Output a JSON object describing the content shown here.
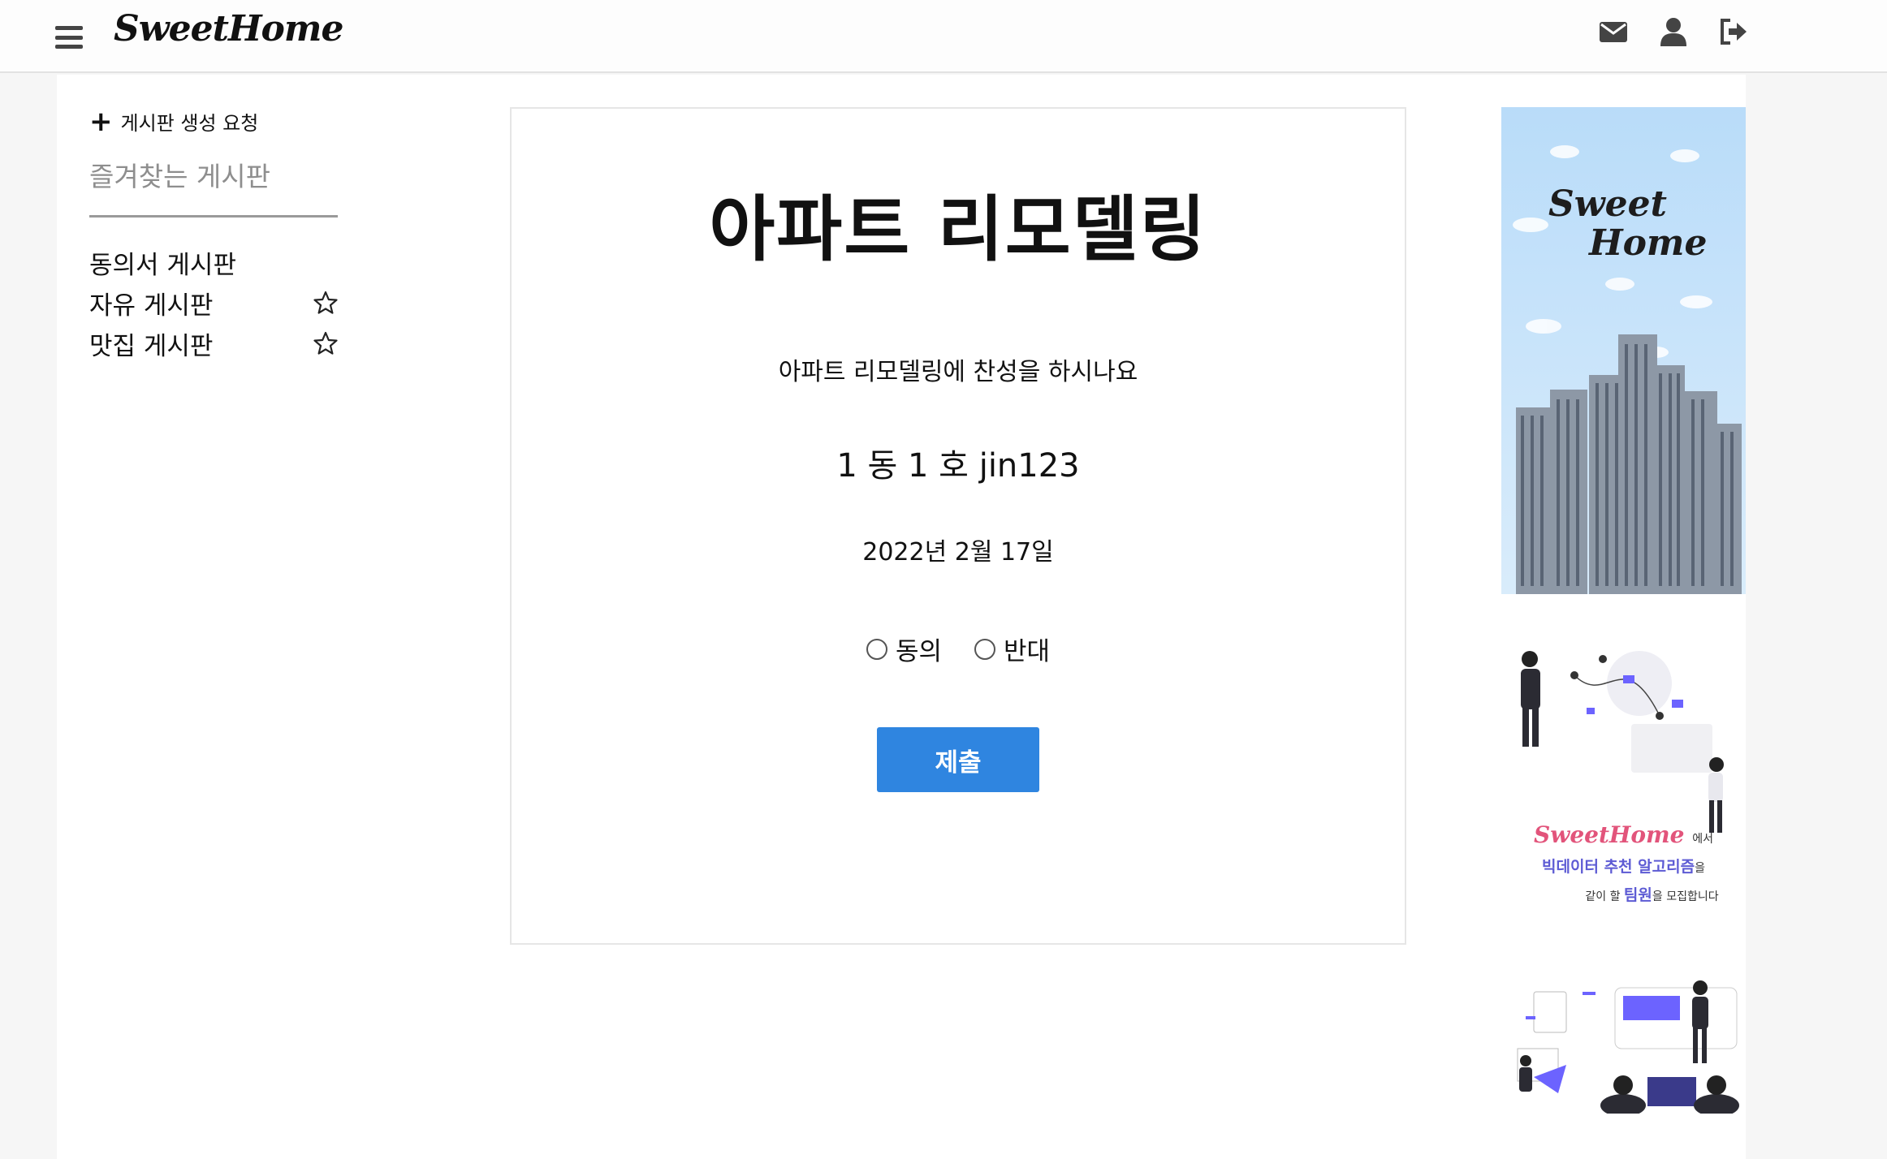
{
  "navbar": {
    "brand": "SweetHome",
    "icons": [
      "menu-icon",
      "envelope-icon",
      "user-icon",
      "sign-out-icon"
    ]
  },
  "sidebar": {
    "create_board_label": "게시판 생성 요청",
    "favorites_title": "즐겨찾는 게시판",
    "boards": [
      {
        "label": "동의서 게시판",
        "starred": false,
        "has_star": false
      },
      {
        "label": "자유 게시판",
        "has_star": true
      },
      {
        "label": "맛집 게시판",
        "has_star": true
      }
    ]
  },
  "vote": {
    "title": "아파트 리모델링",
    "question": "아파트 리모델링에 찬성을 하시나요",
    "author": "1 동 1 호 jin123",
    "date": "2022년 2월 17일",
    "options": [
      {
        "label": "동의",
        "selected": false
      },
      {
        "label": "반대",
        "selected": false
      }
    ],
    "submit_label": "제출"
  },
  "ads": {
    "ad1": {
      "line1": "Sweet",
      "line2": "Home"
    },
    "ad2": {
      "brand": "SweetHome",
      "brand_suffix": "에서",
      "line2_highlight": "빅데이터 추천 알고리즘",
      "line2_suffix": "을",
      "line3_prefix": "같이 할",
      "line3_highlight": "팀원",
      "line3_suffix": "을 모집합니다"
    }
  },
  "colors": {
    "accent": "#2f85e0",
    "sidebar_muted": "#8e8e8e",
    "ad_brand_pink": "#e2547b",
    "ad_highlight_purple": "#5d5bd4"
  }
}
